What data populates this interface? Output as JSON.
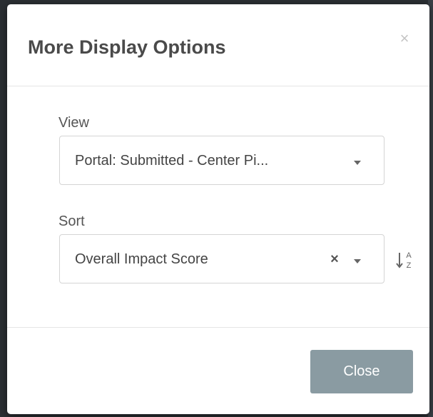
{
  "modal": {
    "title": "More Display Options",
    "close_icon": "×"
  },
  "view": {
    "label": "View",
    "selected": "Portal: Submitted - Center Pi..."
  },
  "sort": {
    "label": "Sort",
    "selected": "Overall Impact Score",
    "clear_icon": "×",
    "direction_icon": {
      "name": "sort-alpha-icon",
      "top_letter": "A",
      "bottom_letter": "Z"
    }
  },
  "footer": {
    "close_label": "Close"
  },
  "colors": {
    "title": "#4a4a4a",
    "close_button_bg": "#8a9ba2",
    "border": "#d4d4d4",
    "backdrop": "#2b2f33"
  }
}
